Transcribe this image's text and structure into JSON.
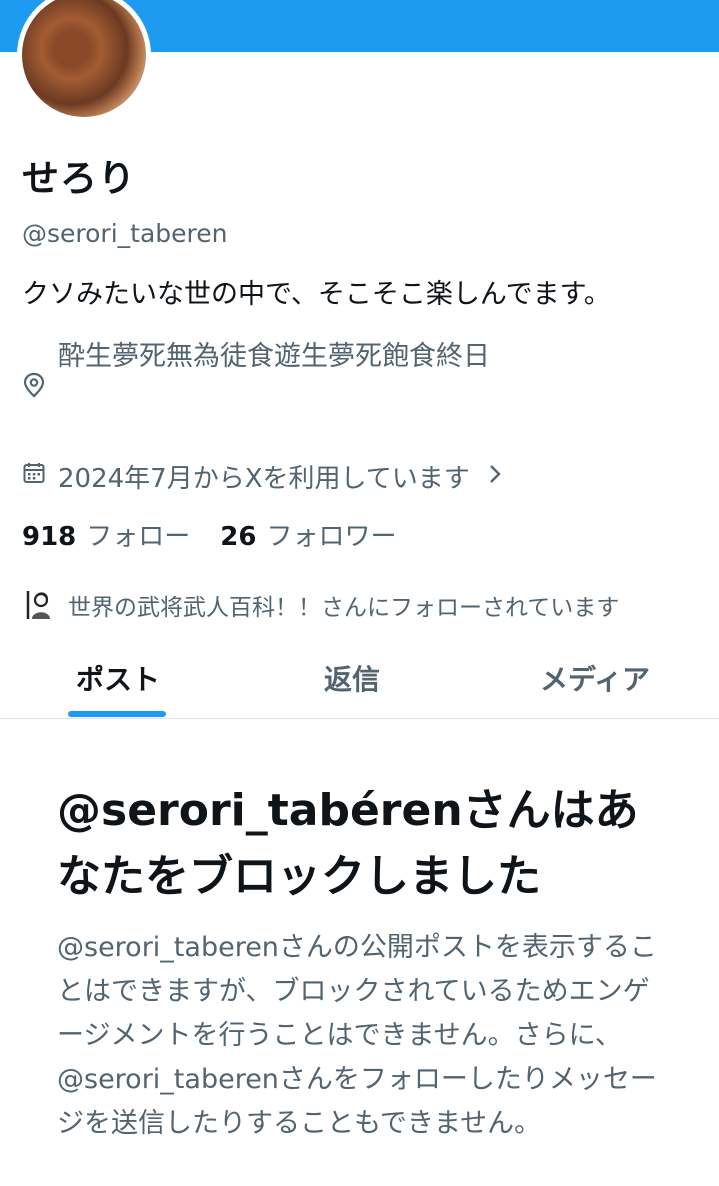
{
  "profile": {
    "display_name": "せろり",
    "handle": "@serori_taberen",
    "bio": "クソみたいな世の中で、そこそこ楽しんでます。",
    "location": "酔生夢死無為徒食遊生夢死飽食終日",
    "joined": "2024年7月からXを利用しています",
    "following_count": "918",
    "following_label": "フォロー",
    "followers_count": "26",
    "followers_label": "フォロワー",
    "followed_by": "世界の武将武人百科！！さんにフォローされています"
  },
  "tabs": [
    {
      "label": "ポスト",
      "active": true
    },
    {
      "label": "返信",
      "active": false
    },
    {
      "label": "メディア",
      "active": false
    }
  ],
  "block_notice": {
    "title": "@serori_tabérenさんはあなたをブロックしました",
    "description": "@serori_taberenさんの公開ポストを表示することはできますが、ブロックされているためエンゲージメントを行うことはできません。さらに、@serori_taberenさんをフォローしたりメッセージを送信したりすることもできません。"
  },
  "colors": {
    "accent": "#1d9bf0",
    "secondary_text": "#536471",
    "primary_text": "#0f1419"
  },
  "icons": [
    "location-icon",
    "calendar-icon",
    "chevron-right-icon"
  ]
}
